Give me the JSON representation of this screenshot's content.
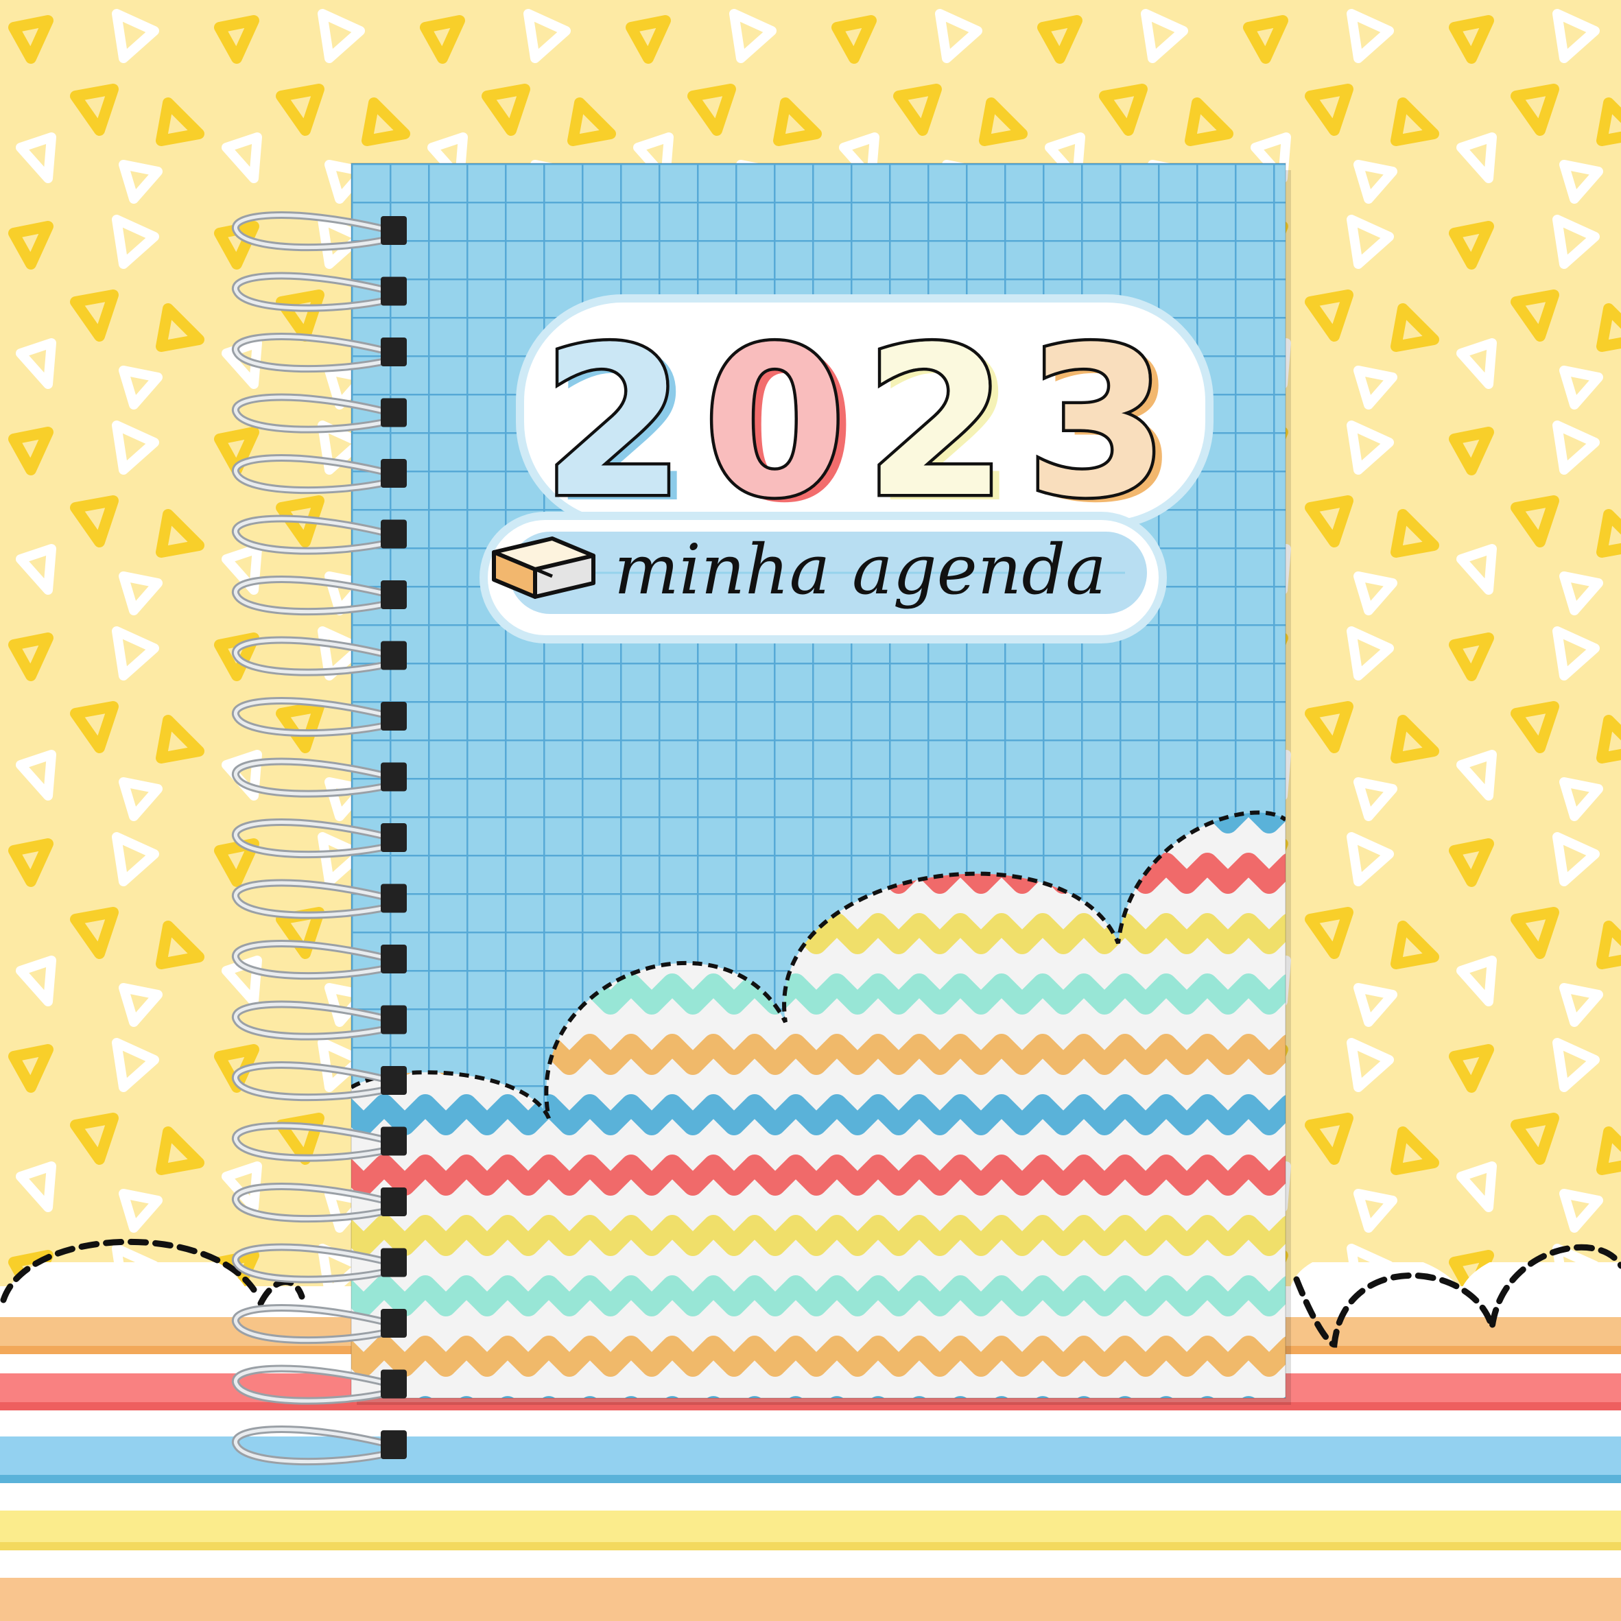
{
  "cover": {
    "year_digits": [
      {
        "char": "2",
        "color": "#8ccbe9"
      },
      {
        "char": "0",
        "color": "#f26d6d"
      },
      {
        "char": "2",
        "color": "#f5f2b6"
      },
      {
        "char": "3",
        "color": "#f2b76e"
      }
    ],
    "subtitle": "minha agenda",
    "icon": "eraser-icon"
  },
  "colors": {
    "background": "#fdeaa4",
    "cover_blue": "#96d3ec",
    "grid_line": "#56a9d6",
    "stripe_orange": "#f0b96a",
    "stripe_blue": "#5ab2d9",
    "stripe_red": "#f06a6a",
    "stripe_yellow": "#f0df6a",
    "stripe_mint": "#98e6d6",
    "triangle_yellow": "#f8cf2a",
    "triangle_white": "#ffffff"
  }
}
